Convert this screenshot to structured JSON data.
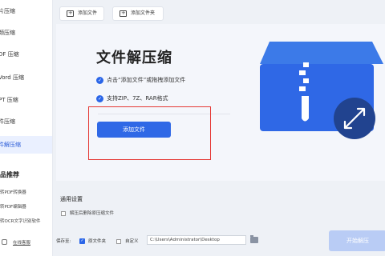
{
  "sidebar": {
    "items": [
      {
        "label": "片压缩"
      },
      {
        "label": "频压缩"
      },
      {
        "label": "DF 压缩"
      },
      {
        "label": "Vord 压缩"
      },
      {
        "label": "PT 压缩"
      },
      {
        "label": "件压缩"
      },
      {
        "label": "件解压缩"
      }
    ],
    "recommend_title": "品推荐",
    "recommend_items": [
      "转PDF转换器",
      "转PDF编辑器",
      "转OCR文字识别软件"
    ],
    "online_label": "在线客服"
  },
  "toolbar": {
    "add_file": "添加文件",
    "add_folder": "添加文件夹"
  },
  "main": {
    "title": "文件解压缩",
    "features": [
      "点击“添加文件”或拖拽添加文件",
      "支持ZIP、7Z、RAR格式"
    ],
    "add_button": "添加文件"
  },
  "settings": {
    "title": "通用设置",
    "option": "解压后删除原压缩文件"
  },
  "bottom": {
    "save_to_label": "保存至:",
    "original_folder": "原文件夹",
    "custom": "自定义",
    "path": "C:\\Users\\Administrator\\Desktop",
    "start_button": "开始解压"
  },
  "colors": {
    "accent": "#2f68e6",
    "highlight_box": "#e53935",
    "disabled_button": "#b9ccf5"
  }
}
